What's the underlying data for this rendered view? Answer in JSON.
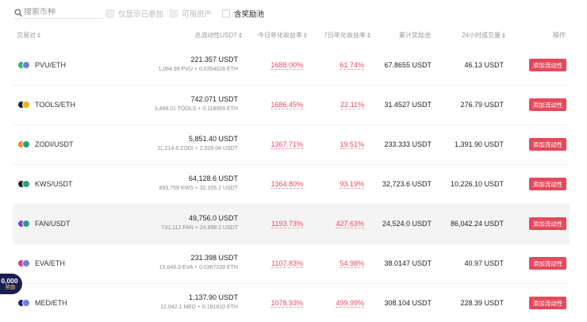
{
  "filters": {
    "search_placeholder": "搜索币种",
    "only_joined": "仅显示已参加",
    "available_assets": "可用资产",
    "reward_pool": "含奖励池"
  },
  "headers": {
    "pair": "交易对",
    "total_liquidity": "总流动性USDT",
    "today_apr": "今日年化收益率",
    "apr_7d": "7日年化收益率",
    "cumulative_reward": "累计奖励池",
    "volume_24h": "24小时成交量",
    "action": "操作"
  },
  "rows": [
    {
      "pair": "PVU/ETH",
      "liquidity": "221.357 USDT",
      "liquidity_detail": "1,084.99 PVU + 0.0354028 ETH",
      "today_apr": "1688.00%",
      "apr_7d": "61.74%",
      "reward": "67.8655 USDT",
      "volume": "46.13 USDT",
      "action": "添加流动性",
      "icon_colors": [
        "#27b86b",
        "#6c7fe0"
      ]
    },
    {
      "pair": "TOOLS/ETH",
      "liquidity": "742.071 USDT",
      "liquidity_detail": "3,488.01 TOOLS + 0.118969 ETH",
      "today_apr": "1686.45%",
      "apr_7d": "22.11%",
      "reward": "31.4527 USDT",
      "volume": "276.79 USDT",
      "action": "添加流动性",
      "icon_colors": [
        "#222222",
        "#f0b400"
      ]
    },
    {
      "pair": "ZODI/USDT",
      "liquidity": "5,851.40 USDT",
      "liquidity_detail": "11,214.8 ZODI + 2,928.04 USDT",
      "today_apr": "1367.71%",
      "apr_7d": "19.51%",
      "reward": "233.333 USDT",
      "volume": "1,391.90 USDT",
      "action": "添加流动性",
      "icon_colors": [
        "#f28c28",
        "#26a17b"
      ]
    },
    {
      "pair": "KWS/USDT",
      "liquidity": "64,128.6 USDT",
      "liquidity_detail": "893,759 KWS + 32,105.2 USDT",
      "today_apr": "1364.80%",
      "apr_7d": "93.19%",
      "reward": "32,723.6 USDT",
      "volume": "10,226.10 USDT",
      "action": "添加流动性",
      "icon_colors": [
        "#1f2a2a",
        "#26a17b"
      ]
    },
    {
      "pair": "FAN/USDT",
      "liquidity": "49,756.0 USDT",
      "liquidity_detail": "731,112 FAN + 24,898.2 USDT",
      "today_apr": "1193.73%",
      "apr_7d": "427.63%",
      "reward": "24,524.0 USDT",
      "volume": "86,042.24 USDT",
      "action": "添加流动性",
      "icon_colors": [
        "#7b3fe4",
        "#26a17b"
      ]
    },
    {
      "pair": "EVA/ETH",
      "liquidity": "231.398 USDT",
      "liquidity_detail": "15,648.3 EVA + 0.0367239 ETH",
      "today_apr": "1107.83%",
      "apr_7d": "54.98%",
      "reward": "38.0147 USDT",
      "volume": "40.97 USDT",
      "action": "添加流动性",
      "icon_colors": [
        "#e0359a",
        "#6c7fe0"
      ]
    },
    {
      "pair": "MED/ETH",
      "liquidity": "1,137.90 USDT",
      "liquidity_detail": "12,042.1 MED + 0.181810 ETH",
      "today_apr": "1078.93%",
      "apr_7d": "499.99%",
      "reward": "308.104 USDT",
      "volume": "228.39 USDT",
      "action": "添加流动性",
      "icon_colors": [
        "#1d2a6b",
        "#6c7fe0"
      ]
    }
  ],
  "promo": {
    "line1": "0,000",
    "line2": "奖励"
  }
}
